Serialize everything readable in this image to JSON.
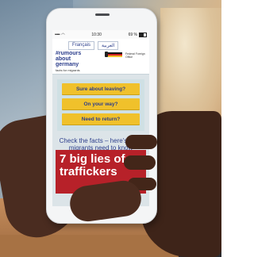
{
  "phone": {
    "status": {
      "carrier_dots": "•••••",
      "wifi": "◠",
      "time": "10:30",
      "battery": "69 %"
    },
    "languages": [
      "Français",
      "العربية"
    ],
    "logo": {
      "line1": "#rumours",
      "line2": "about",
      "line3": "germany",
      "subtitle": "facts for migrants"
    },
    "office": "Federal Foreign Office",
    "questions": [
      "Sure about leaving?",
      "On your way?",
      "Need to return?"
    ],
    "check_text": "Check the facts – here's what migrants need to know",
    "banner": {
      "text": "7 big lies of traffickers",
      "share_icon": "<"
    }
  },
  "colors": {
    "accent_blue": "#2c3e8c",
    "button_yellow": "#f0c12b",
    "banner_red": "#b72129"
  }
}
